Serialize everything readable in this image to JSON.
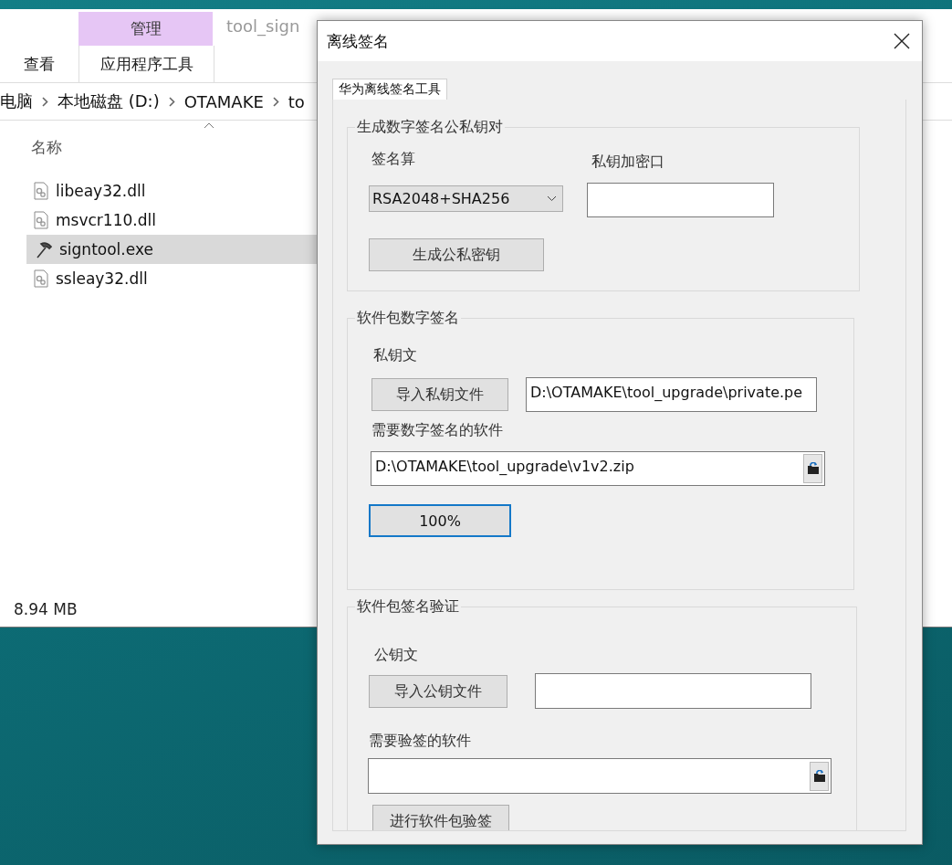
{
  "explorer": {
    "ribbon": {
      "context_group": "管理",
      "context_tab": "应用程序工具",
      "tabs": [
        "查看"
      ],
      "window_title": "tool_sign"
    },
    "breadcrumb": [
      "电脑",
      "本地磁盘 (D:)",
      "OTAMAKE",
      "to"
    ],
    "column_header": "名称",
    "files": [
      {
        "name": "libeay32.dll",
        "kind": "dll",
        "selected": false
      },
      {
        "name": "msvcr110.dll",
        "kind": "dll",
        "selected": false
      },
      {
        "name": "signtool.exe",
        "kind": "exe",
        "selected": true
      },
      {
        "name": "ssleay32.dll",
        "kind": "dll",
        "selected": false
      }
    ],
    "status": "8.94 MB"
  },
  "dialog": {
    "title": "离线签名",
    "tab": "华为离线签名工具",
    "generate": {
      "title": "生成数字签名公私钥对",
      "algorithm_label": "签名算",
      "algorithm": "RSA2048+SHA256",
      "password_label": "私钥加密口",
      "button": "生成公私密钥"
    },
    "sign": {
      "title": "软件包数字签名",
      "key_label": "私钥文",
      "import_button": "导入私钥文件",
      "key_path": "D:\\OTAMAKE\\tool_upgrade\\private.pe",
      "package_label": "需要数字签名的软件",
      "package_path": "D:\\OTAMAKE\\tool_upgrade\\v1v2.zip",
      "progress": "100%"
    },
    "verify": {
      "title": "软件包签名验证",
      "key_label": "公钥文",
      "import_button": "导入公钥文件",
      "package_label": "需要验签的软件",
      "button": "进行软件包验签"
    }
  }
}
